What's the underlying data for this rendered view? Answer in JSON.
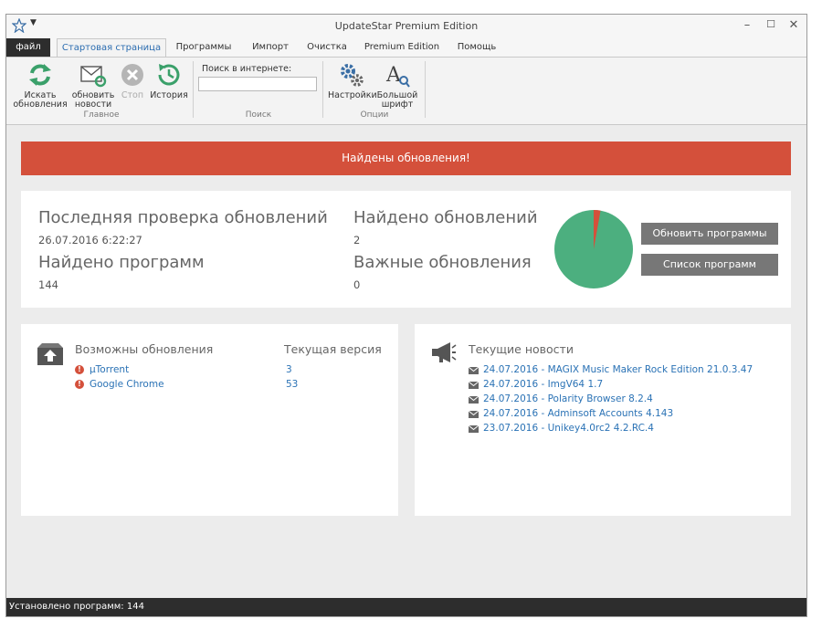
{
  "window": {
    "title": "UpdateStar Premium Edition",
    "controls": {
      "minimize": "–",
      "maximize": "☐",
      "close": "✕"
    }
  },
  "menu": {
    "file": "файл",
    "tabs": [
      "Стартовая страница",
      "Программы",
      "Импорт",
      "Очистка",
      "Premium Edition",
      "Помощь"
    ],
    "active_tab": "Стартовая страница"
  },
  "ribbon": {
    "main_group": {
      "label": "Главное",
      "search_updates": "Искать обновления",
      "update_news": "обновить новости",
      "stop": "Стоп",
      "history": "История"
    },
    "search_group": {
      "label": "Поиск",
      "search_label": "Поиск в интернете:",
      "search_value": ""
    },
    "options_group": {
      "label": "Опции",
      "settings": "Настройки",
      "large_font": "Большой шрифт"
    }
  },
  "banner": {
    "text": "Найдены обновления!",
    "color": "#d4503b"
  },
  "summary": {
    "last_check_label": "Последняя проверка обновлений",
    "last_check_value": "26.07.2016 6:22:27",
    "programs_found_label": "Найдено программ",
    "programs_found_value": "144",
    "updates_found_label": "Найдено обновлений",
    "updates_found_value": "2",
    "important_updates_label": "Важные обновления",
    "important_updates_value": "0",
    "update_button": "Обновить программы",
    "list_button": "Список программ",
    "pie": {
      "updates_fraction": 0.028,
      "main_color": "#4caf7f",
      "slice_color": "#d4503b"
    }
  },
  "updates_panel": {
    "title": "Возможны обновления",
    "version_header": "Текущая версия",
    "items": [
      {
        "name": "µTorrent",
        "version": "3"
      },
      {
        "name": "Google Chrome",
        "version": "53"
      }
    ]
  },
  "news_panel": {
    "title": "Текущие новости",
    "items": [
      "24.07.2016 - MAGIX Music Maker Rock Edition 21.0.3.47",
      "24.07.2016 - ImgV64 1.7",
      "24.07.2016 - Polarity Browser 8.2.4",
      "24.07.2016 - Adminsoft Accounts 4.143",
      "23.07.2016 - Unikey4.0rc2 4.2.RC.4"
    ]
  },
  "status": {
    "text": "Установлено программ: 144"
  }
}
